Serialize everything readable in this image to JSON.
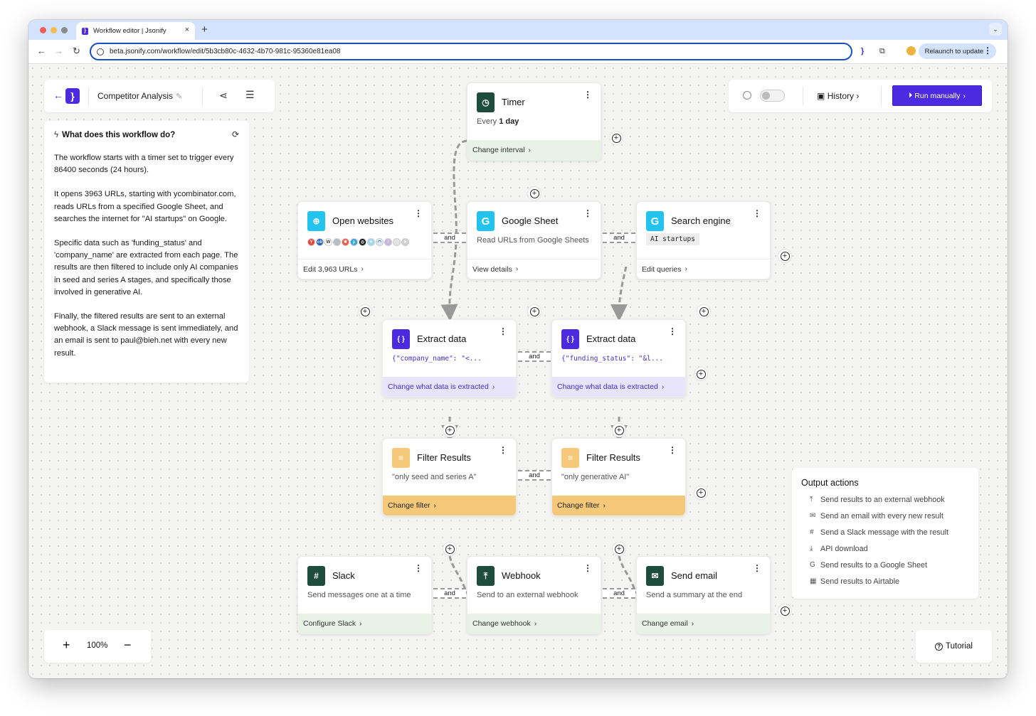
{
  "browser": {
    "tab_title": "Workflow editor | Jsonify",
    "url": "beta.jsonify.com/workflow/edit/5b3cb80c-4632-4b70-981c-95360e81ea08",
    "relaunch_label": "Relaunch to update",
    "new_tab_icon": "+",
    "close_icon": "×"
  },
  "header": {
    "back_icon": "←",
    "logo_glyph": "}",
    "workflow_title": "Competitor Analysis",
    "edit_icon": "✎",
    "share_icon": "share-icon",
    "menu_icon": "☰"
  },
  "description": {
    "title": "What does this workflow do?",
    "bolt_icon": "ϟ",
    "refresh_icon": "⟳",
    "paragraphs": [
      "The workflow starts with a timer set to trigger every 86400 seconds (24 hours).",
      "It opens 3963 URLs, starting with ycombinator.com, reads URLs from a specified Google Sheet, and searches the internet for \"AI startups\" on Google.",
      "Specific data such as 'funding_status' and 'company_name' are extracted from each page. The results are then filtered to include only AI companies in seed and series A stages, and specifically those involved in generative AI.",
      "Finally, the filtered results are sent to an external webhook, a Slack message is sent immediately, and an email is sent to paul@bieh.net with every new result."
    ]
  },
  "controls": {
    "schedule_enabled": false,
    "history_label": "History",
    "run_label": "Run manually",
    "chevron": "›"
  },
  "nodes": {
    "timer": {
      "title": "Timer",
      "body_prefix": "Every ",
      "body_bold": "1 day",
      "footer": "Change interval",
      "icon": "clock-icon",
      "color": "#1e4d3d"
    },
    "open_websites": {
      "title": "Open websites",
      "footer": "Edit 3,963 URLs",
      "icon": "globe-icon",
      "color": "#22c3ee",
      "favicons": [
        {
          "label": "Y",
          "color": "#e8453c"
        },
        {
          "label": "cb",
          "color": "#1b59c8"
        },
        {
          "label": "W",
          "color": "#ffffff"
        },
        {
          "label": "",
          "color": "#b8bcc4"
        },
        {
          "label": "✱",
          "color": "#f0533a"
        },
        {
          "label": "p",
          "color": "#2aa7e0"
        },
        {
          "label": "◎",
          "color": "#111111"
        },
        {
          "label": "✦",
          "color": "#9fd8f0"
        },
        {
          "label": "◠",
          "color": "#d7eef8"
        },
        {
          "label": "/",
          "color": "#c9b3e6"
        },
        {
          "label": "",
          "color": "#e3e3e3"
        },
        {
          "label": "➤",
          "color": "#cfcfcf"
        }
      ]
    },
    "google_sheet": {
      "title": "Google Sheet",
      "body": "Read URLs from Google Sheets",
      "footer": "View details",
      "icon": "google-icon",
      "color": "#22c3ee"
    },
    "search_engine": {
      "title": "Search engine",
      "chip": "AI startups",
      "footer": "Edit queries",
      "icon": "google-icon",
      "color": "#22c3ee"
    },
    "extract_1": {
      "title": "Extract data",
      "code": "{\"company_name\": \"<...",
      "footer": "Change what data is extracted",
      "icon": "braces-icon",
      "color": "#4b2ae0"
    },
    "extract_2": {
      "title": "Extract data",
      "code": "{\"funding_status\": \"&l...",
      "footer": "Change what data is extracted",
      "icon": "braces-icon",
      "color": "#4b2ae0"
    },
    "filter_1": {
      "title": "Filter Results",
      "body": "\"only seed and series A\"",
      "footer": "Change filter",
      "icon": "filter-icon",
      "color": "#f6c97a"
    },
    "filter_2": {
      "title": "Filter Results",
      "body": "\"only generative AI\"",
      "footer": "Change filter",
      "icon": "filter-icon",
      "color": "#f6c97a"
    },
    "slack": {
      "title": "Slack",
      "body": "Send messages one at a time",
      "footer": "Configure Slack",
      "icon": "slack-icon",
      "color": "#1e4d3d"
    },
    "webhook": {
      "title": "Webhook",
      "body": "Send to an external webhook",
      "footer": "Change webhook",
      "icon": "upload-icon",
      "color": "#1e4d3d"
    },
    "send_email": {
      "title": "Send email",
      "body": "Send a summary at the end",
      "footer": "Change email",
      "icon": "mail-icon",
      "color": "#1e4d3d"
    }
  },
  "connector_label": "and",
  "output_actions": {
    "title": "Output actions",
    "items": [
      {
        "icon": "⤒",
        "label": "Send results to an external webhook"
      },
      {
        "icon": "✉",
        "label": "Send an email with every new result"
      },
      {
        "icon": "#",
        "label": "Send a Slack message with the result"
      },
      {
        "icon": "⤓",
        "label": "API download"
      },
      {
        "icon": "G",
        "label": "Send results to a Google Sheet"
      },
      {
        "icon": "▦",
        "label": "Send results to Airtable"
      }
    ]
  },
  "zoom": {
    "plus": "+",
    "value": "100%",
    "minus": "−"
  },
  "tutorial": {
    "label": "Tutorial",
    "icon": "?"
  }
}
